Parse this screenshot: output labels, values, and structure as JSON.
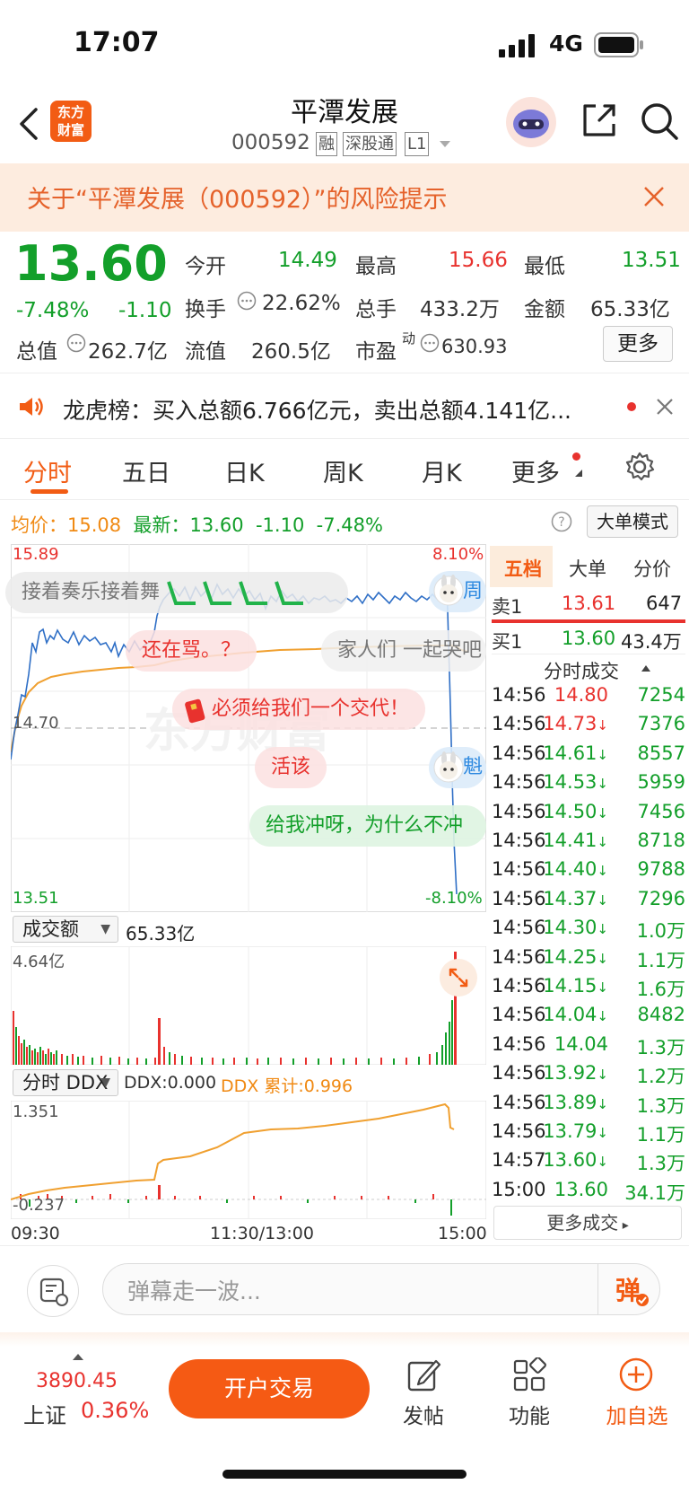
{
  "status_bar": {
    "time": "17:07",
    "network": "4G"
  },
  "nav": {
    "logo_text": "东方\n财富",
    "title": "平潭发展",
    "code": "000592",
    "tags": [
      "融",
      "深股通",
      "L1"
    ]
  },
  "risk_banner": {
    "text": "关于“平潭发展（000592）”的风险提示"
  },
  "quote": {
    "price": "13.60",
    "change_pct": "-7.48%",
    "change": "-1.10",
    "open_label": "今开",
    "open": "14.49",
    "high_label": "最高",
    "high": "15.66",
    "low_label": "最低",
    "low": "13.51",
    "turnover_label": "换手",
    "turnover": "22.62%",
    "volume_label": "总手",
    "volume": "433.2万",
    "amount_label": "金额",
    "amount": "65.33亿",
    "mcap_label": "总值",
    "mcap": "262.7亿",
    "float_label": "流值",
    "float_cap": "260.5亿",
    "pe_label": "市盈",
    "pe_sup": "动",
    "pe": "630.93",
    "more_label": "更多"
  },
  "lhb": {
    "text": "龙虎榜：买入总额6.766亿元，卖出总额4.141亿..."
  },
  "tabs": [
    "分时",
    "五日",
    "日K",
    "周K",
    "月K",
    "更多"
  ],
  "info": {
    "avg_label": "均价：",
    "avg": "15.08",
    "latest_label": "最新：",
    "latest": "13.60",
    "change": "-1.10",
    "change_pct": "-7.48%",
    "big_order_btn": "大单模式"
  },
  "chart": {
    "y_top": "15.89",
    "y_mid": "14.70",
    "y_bottom": "13.51",
    "pct_top": "8.10%",
    "pct_bottom": "-8.10%",
    "colors": {
      "price_line": "#2f6fc6",
      "avg_line": "#f0a030",
      "up": "#e8322e",
      "down": "#139f2a"
    }
  },
  "danmu": [
    {
      "text": "接着奏乐接着舞"
    },
    {
      "text": "还在骂。？"
    },
    {
      "text": "家人们 一起哭吧"
    },
    {
      "text": "必须给我们一个交代！"
    },
    {
      "text": "活该"
    },
    {
      "text": "给我冲呀，为什么不冲"
    },
    {
      "text": "周"
    },
    {
      "text": "魁"
    }
  ],
  "volume_panel": {
    "selector": "成交额",
    "total": "65.33亿",
    "max_label": "4.64亿"
  },
  "ddx_panel": {
    "selector": "分时 DDX",
    "ddx_label": "DDX:0.000",
    "ddx_cum_label": "DDX 累计:0.996",
    "y_top": "1.351",
    "y_bottom": "-0.237"
  },
  "time_axis": {
    "start": "09:30",
    "mid": "11:30/13:00",
    "end": "15:00"
  },
  "order_book": {
    "tabs": [
      "五档",
      "大单",
      "分价"
    ],
    "sell1_label": "卖1",
    "sell1_price": "13.61",
    "sell1_vol": "647",
    "buy1_label": "买1",
    "buy1_price": "13.60",
    "buy1_vol": "43.4万",
    "trades_header": "分时成交",
    "trades": [
      {
        "time": "14:56",
        "price": "14.80",
        "arrow": "",
        "vol": "7254"
      },
      {
        "time": "14:56",
        "price": "14.73",
        "arrow": "↓",
        "vol": "7376"
      },
      {
        "time": "14:56",
        "price": "14.61",
        "arrow": "↓",
        "vol": "8557"
      },
      {
        "time": "14:56",
        "price": "14.53",
        "arrow": "↓",
        "vol": "5959"
      },
      {
        "time": "14:56",
        "price": "14.50",
        "arrow": "↓",
        "vol": "7456"
      },
      {
        "time": "14:56",
        "price": "14.41",
        "arrow": "↓",
        "vol": "8718"
      },
      {
        "time": "14:56",
        "price": "14.40",
        "arrow": "↓",
        "vol": "9788"
      },
      {
        "time": "14:56",
        "price": "14.37",
        "arrow": "↓",
        "vol": "7296"
      },
      {
        "time": "14:56",
        "price": "14.30",
        "arrow": "↓",
        "vol": "1.0万"
      },
      {
        "time": "14:56",
        "price": "14.25",
        "arrow": "↓",
        "vol": "1.1万"
      },
      {
        "time": "14:56",
        "price": "14.15",
        "arrow": "↓",
        "vol": "1.6万"
      },
      {
        "time": "14:56",
        "price": "14.04",
        "arrow": "↓",
        "vol": "8482"
      },
      {
        "time": "14:56",
        "price": "14.04",
        "arrow": "",
        "vol": "1.3万"
      },
      {
        "time": "14:56",
        "price": "13.92",
        "arrow": "↓",
        "vol": "1.2万"
      },
      {
        "time": "14:56",
        "price": "13.89",
        "arrow": "↓",
        "vol": "1.3万"
      },
      {
        "time": "14:56",
        "price": "13.79",
        "arrow": "↓",
        "vol": "1.1万"
      },
      {
        "time": "14:57",
        "price": "13.60",
        "arrow": "↓",
        "vol": "1.3万"
      },
      {
        "time": "15:00",
        "price": "13.60",
        "arrow": "",
        "vol": "34.1万"
      }
    ],
    "more_trades": "更多成交"
  },
  "comment_bar": {
    "placeholder": "弹幕走一波...",
    "danmu_btn": "弹"
  },
  "bottom_bar": {
    "index_value": "3890.45",
    "index_name": "上证",
    "index_change": "0.36%",
    "open_account": "开户交易",
    "post": "发帖",
    "functions": "功能",
    "add_watch": "加自选"
  }
}
